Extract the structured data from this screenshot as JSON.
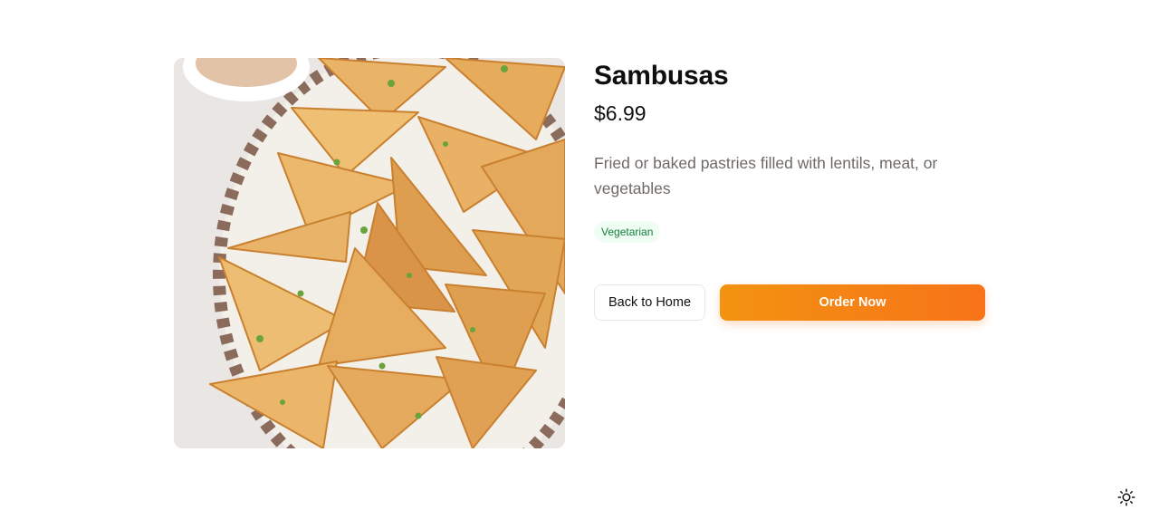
{
  "product": {
    "name": "Sambusas",
    "price": "$6.99",
    "description": "Fried or baked pastries filled with lentils, meat, or vegetables",
    "tags": [
      "Vegetarian"
    ],
    "image_alt": "Sambusas"
  },
  "actions": {
    "back_label": "Back to Home",
    "order_label": "Order Now"
  },
  "theme_toggle": {
    "icon": "sun-icon"
  },
  "colors": {
    "accent_start": "#f39311",
    "accent_end": "#f77318",
    "tag_text": "#15803d",
    "tag_bg": "#f0fdf4"
  }
}
